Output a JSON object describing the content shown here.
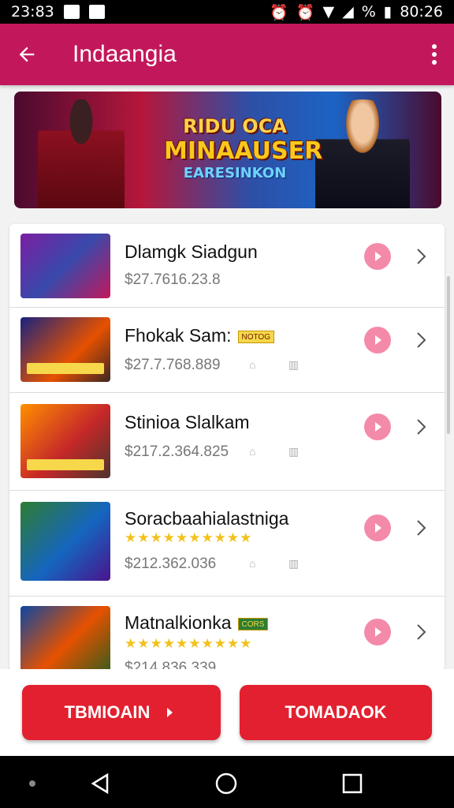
{
  "status_bar": {
    "time": "23:83",
    "battery_text": "%",
    "clock_right": "80:26"
  },
  "app_bar": {
    "title": "Indaangia",
    "back_icon": "arrow-left-icon",
    "menu_icon": "more-vert-icon"
  },
  "banner": {
    "line1": "RIDU OCA",
    "line2": "MINAAUSER",
    "line3": "EARESINKON"
  },
  "list": {
    "items": [
      {
        "name": "Dlamgk Siadgun",
        "price": "$27.7616.23.8",
        "tag": "",
        "stars": ""
      },
      {
        "name": "Fhokak Sam:",
        "price": "$27.7.768.889",
        "tag": "NOTOG",
        "stars": ""
      },
      {
        "name": "Stinioa Slalkam",
        "price": "$217.2.364.825",
        "tag": "",
        "stars": ""
      },
      {
        "name": "Soracbaahialastniga",
        "price": "$212.362.036",
        "tag": "",
        "stars": "★★★★★★★★★★"
      },
      {
        "name": "Matnalkionka",
        "price": "$214.836.339",
        "tag": "CORS",
        "stars": "★★★★★★★★★★"
      }
    ]
  },
  "buttons": {
    "left_label": "TBMIOAIN",
    "right_label": "TOMADAOK"
  },
  "colors": {
    "primary": "#c2185b",
    "accent": "#e3202f",
    "play": "#f48aa9"
  }
}
